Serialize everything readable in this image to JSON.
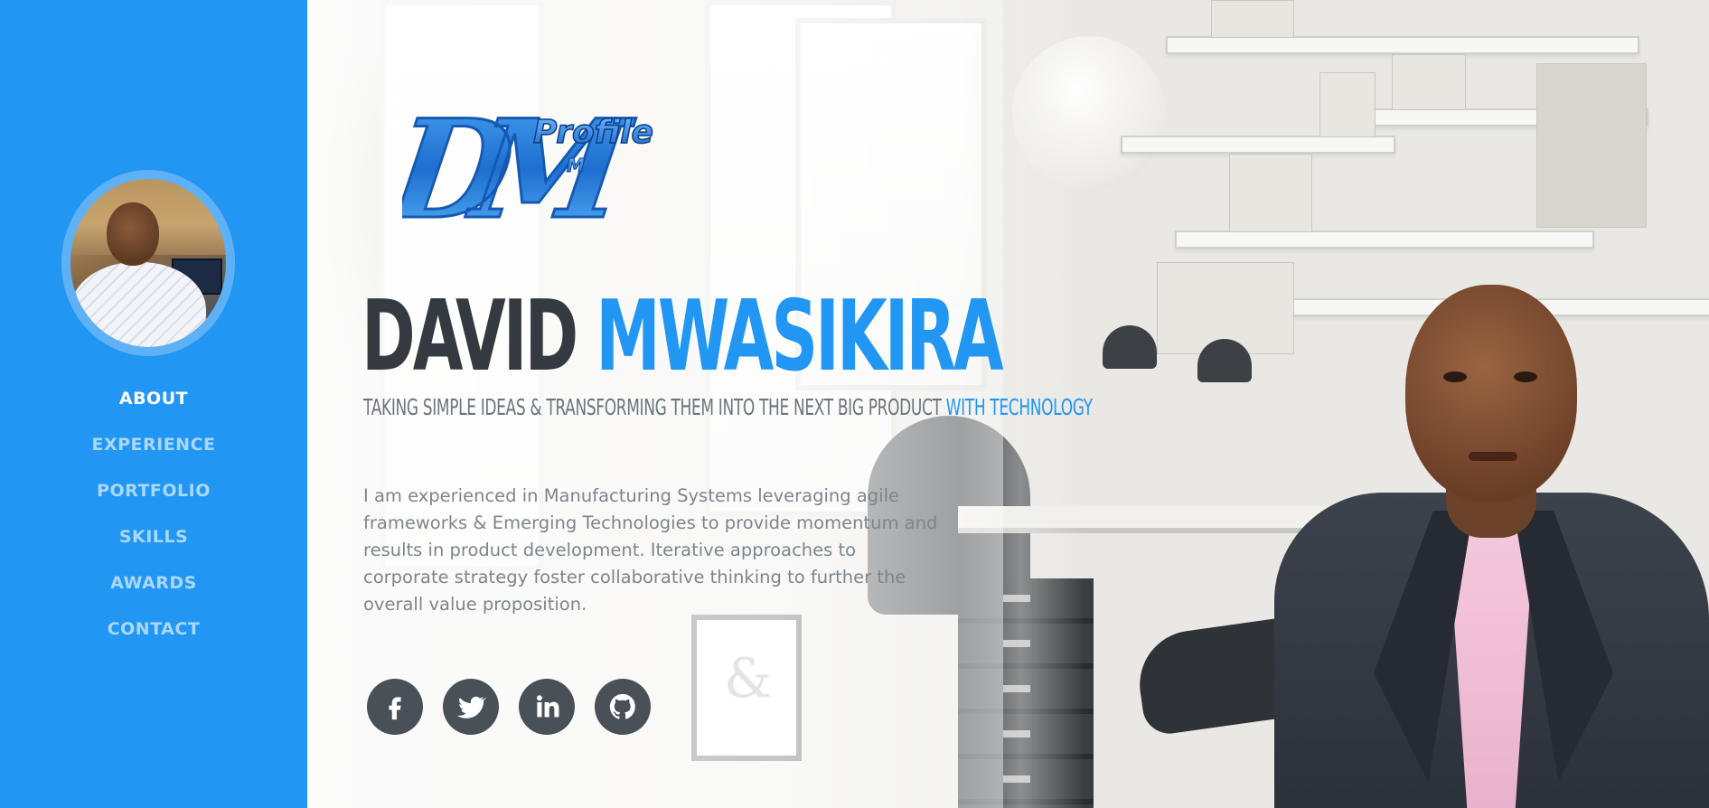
{
  "sidebar": {
    "avatar_alt": "Profile photo",
    "nav": [
      {
        "label": "ABOUT",
        "active": true
      },
      {
        "label": "EXPERIENCE",
        "active": false
      },
      {
        "label": "PORTFOLIO",
        "active": false
      },
      {
        "label": "SKILLS",
        "active": false
      },
      {
        "label": "AWARDS",
        "active": false
      },
      {
        "label": "CONTACT",
        "active": false
      }
    ]
  },
  "hero": {
    "logo": {
      "initials": "DM",
      "word": "Profile",
      "small": "M"
    },
    "first_name": "DAVID",
    "last_name": "MWASIKIRA",
    "tagline_main": "TAKING SIMPLE IDEAS & TRANSFORMING THEM INTO THE NEXT BIG PRODUCT",
    "tagline_accent": "WITH TECHNOLOGY",
    "bio": "I am experienced in Manufacturing Systems leveraging agile frameworks & Emerging Technologies to provide momentum and results in product development. Iterative approaches to corporate strategy foster collaborative thinking to further the overall value proposition."
  },
  "social": [
    {
      "name": "facebook",
      "icon": "facebook-icon"
    },
    {
      "name": "twitter",
      "icon": "twitter-icon"
    },
    {
      "name": "linkedin",
      "icon": "linkedin-icon"
    },
    {
      "name": "github",
      "icon": "github-icon"
    }
  ],
  "colors": {
    "primary": "#2196f3",
    "dark": "#343a40",
    "muted": "#6c757d",
    "social_bg": "#495057"
  }
}
